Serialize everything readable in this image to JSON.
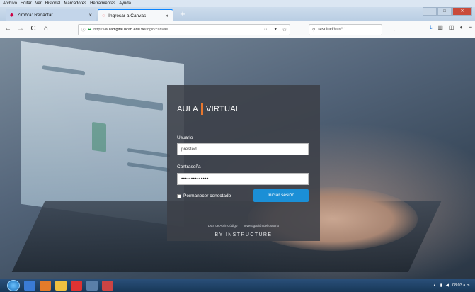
{
  "menubar": {
    "items": [
      "Archivo",
      "Editar",
      "Ver",
      "Historial",
      "Marcadores",
      "Herramientas",
      "Ayuda"
    ]
  },
  "tabs": [
    {
      "title": "Zimbra: Redactar",
      "close": "×"
    },
    {
      "title": "Ingresar a Canvas",
      "close": "×"
    }
  ],
  "new_tab_label": "+",
  "navbar": {
    "back": "←",
    "forward": "→",
    "reload": "C",
    "home": "⌂",
    "url_prefix": "https://",
    "url_host": "auladigital.ucab.edu.ve",
    "url_path": "/login/canvas",
    "page_actions": "···",
    "search_value": "resolución n° 1",
    "search_go": "→"
  },
  "login": {
    "logo_left": "AULA",
    "logo_right": "VIRTUAL",
    "username_label": "Usuario",
    "username_value": "prested",
    "password_label": "Contraseña",
    "password_value": "••••••••••••••",
    "remember_label": "Permanecer conectado",
    "submit_label": "Iniciar sesión",
    "link1": "LMS de Abrir Código",
    "link2": "Investigación del usuario",
    "footer": "BY INSTRUCTURE"
  },
  "taskbar": {
    "clock": "08:03 a.m."
  },
  "colors": {
    "accent": "#1b8fd6",
    "logo_bar": "#e8772e",
    "card_bg": "#3c4048"
  }
}
